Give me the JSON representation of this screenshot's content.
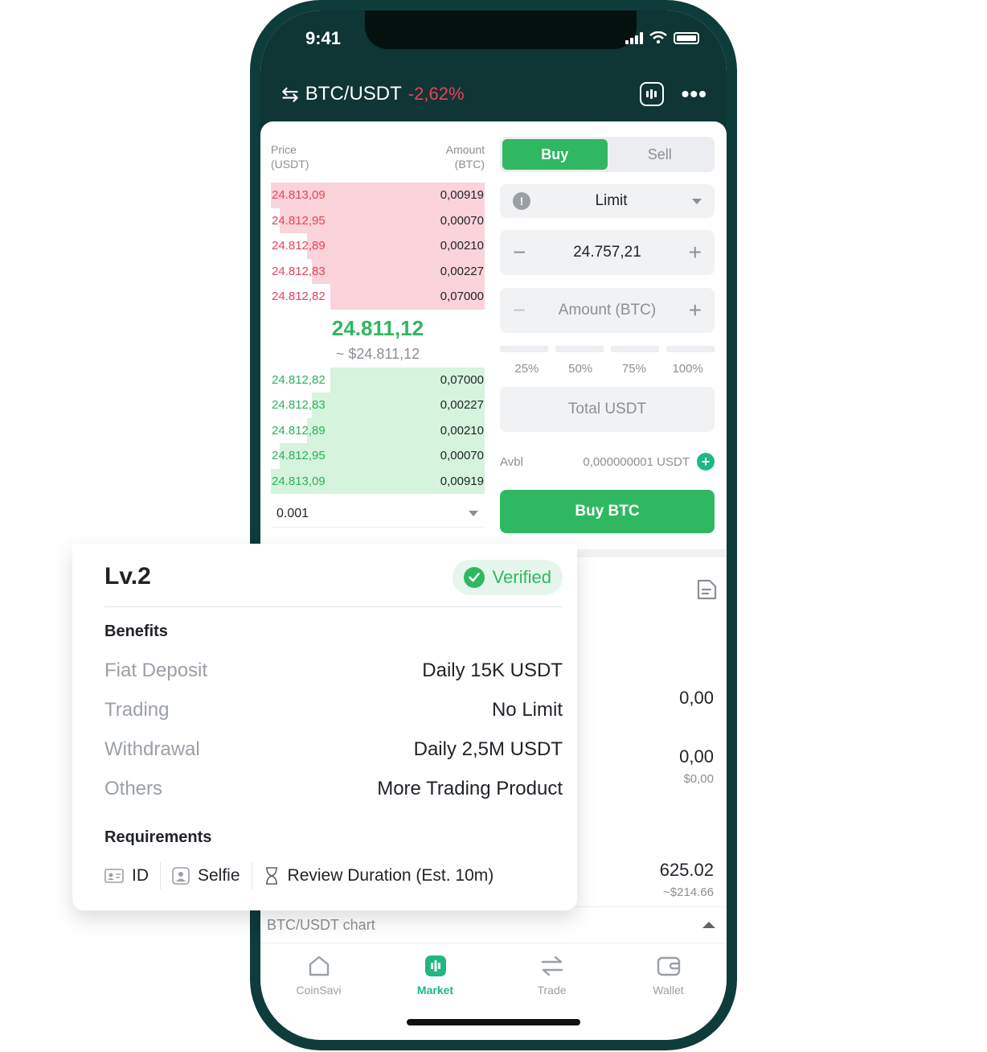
{
  "status": {
    "time": "9:41"
  },
  "header": {
    "pair": "BTC/USDT",
    "change": "-2,62%"
  },
  "orderbook": {
    "price_header": [
      "Price",
      "(USDT)"
    ],
    "amount_header": [
      "Amount",
      "(BTC)"
    ],
    "asks": [
      {
        "price": "24.813,09",
        "amount": "0,00919",
        "depth": 1.0
      },
      {
        "price": "24.812,95",
        "amount": "0,00070",
        "depth": 0.96
      },
      {
        "price": "24.812,89",
        "amount": "0,00210",
        "depth": 0.83
      },
      {
        "price": "24.812,83",
        "amount": "0,00227",
        "depth": 0.81
      },
      {
        "price": "24.812,82",
        "amount": "0,07000",
        "depth": 0.72
      }
    ],
    "mid_price": "24.811,12",
    "mid_usd": "~ $24.811,12",
    "bids": [
      {
        "price": "24.812,82",
        "amount": "0,07000",
        "depth": 0.72
      },
      {
        "price": "24.812,83",
        "amount": "0,00227",
        "depth": 0.81
      },
      {
        "price": "24.812,89",
        "amount": "0,00210",
        "depth": 0.83
      },
      {
        "price": "24.812,95",
        "amount": "0,00070",
        "depth": 0.96
      },
      {
        "price": "24.813,09",
        "amount": "0,00919",
        "depth": 1.0
      }
    ],
    "precision": "0.001"
  },
  "trade": {
    "buy_label": "Buy",
    "sell_label": "Sell",
    "order_type": "Limit",
    "price_value": "24.757,21",
    "amount_placeholder": "Amount (BTC)",
    "pcts": [
      "25%",
      "50%",
      "75%",
      "100%"
    ],
    "total_placeholder": "Total USDT",
    "avbl_label": "Avbl",
    "avbl_value": "0,000000001 USDT",
    "buy_button": "Buy BTC"
  },
  "right_values": [
    {
      "big": "0,00",
      "small": ""
    },
    {
      "big": "0,00",
      "small": "$0,00"
    },
    {
      "big": "625.02",
      "small": "~$214.66"
    }
  ],
  "chart_toggle": "BTC/USDT chart",
  "tabs": [
    {
      "label": "CoinSavi",
      "icon": "home-icon"
    },
    {
      "label": "Market",
      "icon": "market-icon"
    },
    {
      "label": "Trade",
      "icon": "trade-arrows-icon"
    },
    {
      "label": "Wallet",
      "icon": "wallet-icon"
    }
  ],
  "verify_card": {
    "level": "Lv.2",
    "status": "Verified",
    "benefits_title": "Benefits",
    "benefits": [
      {
        "key": "Fiat Deposit",
        "value": "Daily 15K USDT"
      },
      {
        "key": "Trading",
        "value": "No Limit"
      },
      {
        "key": "Withdrawal",
        "value": "Daily 2,5M USDT"
      },
      {
        "key": "Others",
        "value": "More Trading Product"
      }
    ],
    "requirements_title": "Requirements",
    "requirements": [
      "ID",
      "Selfie",
      "Review Duration (Est. 10m)"
    ]
  },
  "colors": {
    "brand_green": "#2fb861",
    "ask_red": "#e9415d",
    "dark_header": "#0f3534"
  }
}
